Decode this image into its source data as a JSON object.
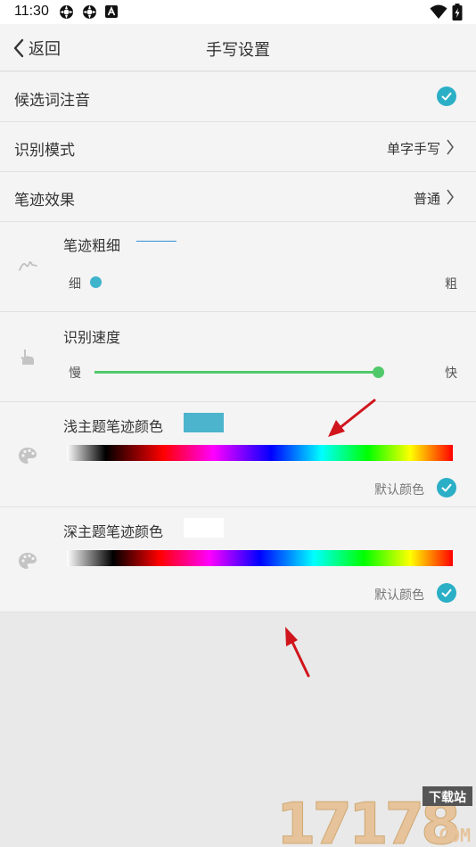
{
  "status": {
    "time": "11:30"
  },
  "nav": {
    "back_label": "返回",
    "title": "手写设置"
  },
  "rows": {
    "pinyin": {
      "label": "候选词注音",
      "checked": true
    },
    "mode": {
      "label": "识别模式",
      "value": "单字手写"
    },
    "effect": {
      "label": "笔迹效果",
      "value": "普通"
    }
  },
  "thickness": {
    "title": "笔迹粗细",
    "min_label": "细",
    "max_label": "粗",
    "level": 0.0,
    "sample_color": "#2f8fd8"
  },
  "speed": {
    "title": "识别速度",
    "min_label": "慢",
    "max_label": "快",
    "level": 1.0
  },
  "light_color": {
    "title": "浅主题笔迹颜色",
    "swatch": "#4db4cd",
    "default_label": "默认颜色",
    "default_checked": true
  },
  "dark_color": {
    "title": "深主题笔迹颜色",
    "swatch": "#ffffff",
    "default_label": "默认颜色",
    "default_checked": true
  },
  "watermark": {
    "digits": "17178",
    "badge": "下载站",
    "domain": ".COM"
  },
  "colors": {
    "accent": "#2bafc6",
    "slider": "#50c96a",
    "arrow": "#d0151c"
  },
  "icons": [
    "back-chevron-icon",
    "check-icon",
    "chevron-right-icon",
    "stroke-icon",
    "hand-pointer-icon",
    "palette-icon"
  ]
}
